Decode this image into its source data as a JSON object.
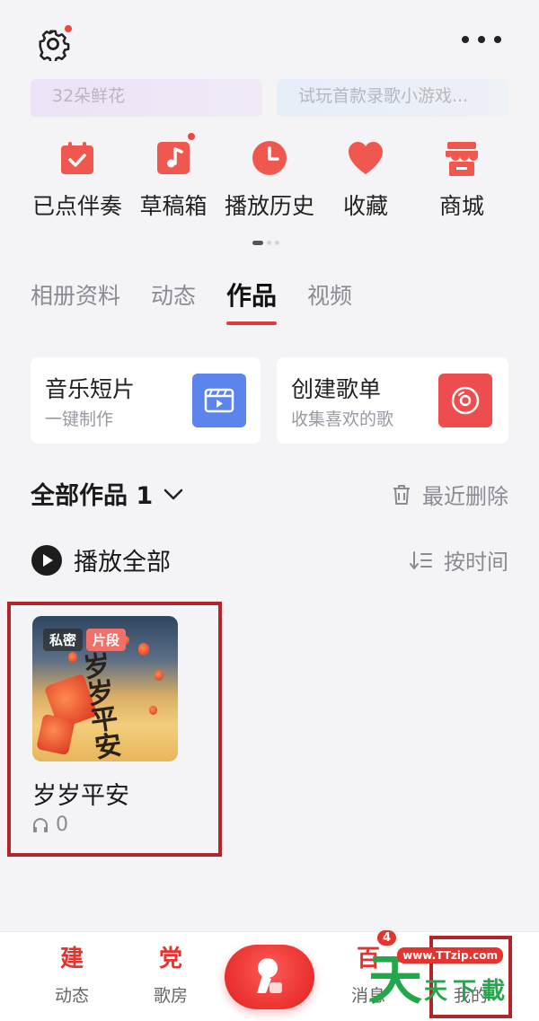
{
  "header": {
    "settings_icon": "gear-icon",
    "more_icon": "more-dots-icon"
  },
  "banners": [
    {
      "text": "32朵鲜花"
    },
    {
      "text": "试玩首款录歌小游戏..."
    }
  ],
  "quick_actions": [
    {
      "label": "已点伴奏",
      "icon": "checklist-icon"
    },
    {
      "label": "草稿箱",
      "icon": "music-note-icon"
    },
    {
      "label": "播放历史",
      "icon": "clock-icon"
    },
    {
      "label": "收藏",
      "icon": "heart-icon"
    },
    {
      "label": "商城",
      "icon": "store-icon"
    }
  ],
  "tabs": [
    {
      "label": "相册资料"
    },
    {
      "label": "动态"
    },
    {
      "label": "作品",
      "active": true
    },
    {
      "label": "视频"
    }
  ],
  "feature_cards": [
    {
      "title": "音乐短片",
      "subtitle": "一键制作",
      "icon": "video-clip-icon",
      "color": "#5b84ec"
    },
    {
      "title": "创建歌单",
      "subtitle": "收集喜欢的歌",
      "icon": "disc-icon",
      "color": "#ee4d4f"
    }
  ],
  "works_header": {
    "title": "全部作品 1",
    "recent_deleted": "最近删除"
  },
  "controls": {
    "play_all": "播放全部",
    "sort": "按时间"
  },
  "works": [
    {
      "title": "岁岁平安",
      "plays": "0",
      "tags": [
        "私密",
        "片段"
      ],
      "cover_text": "岁岁平安"
    }
  ],
  "bottom_nav": [
    {
      "label": "动态",
      "glyph": "建"
    },
    {
      "label": "歌房",
      "glyph": "党"
    },
    {
      "label": "消息",
      "glyph": "百",
      "badge": "4"
    },
    {
      "label": "我的"
    }
  ],
  "watermark": {
    "url": "www.TTzip.com",
    "big": "天",
    "small": "天下載"
  },
  "colors": {
    "accent": "#e3393c",
    "highlight_box": "#b0262b"
  }
}
